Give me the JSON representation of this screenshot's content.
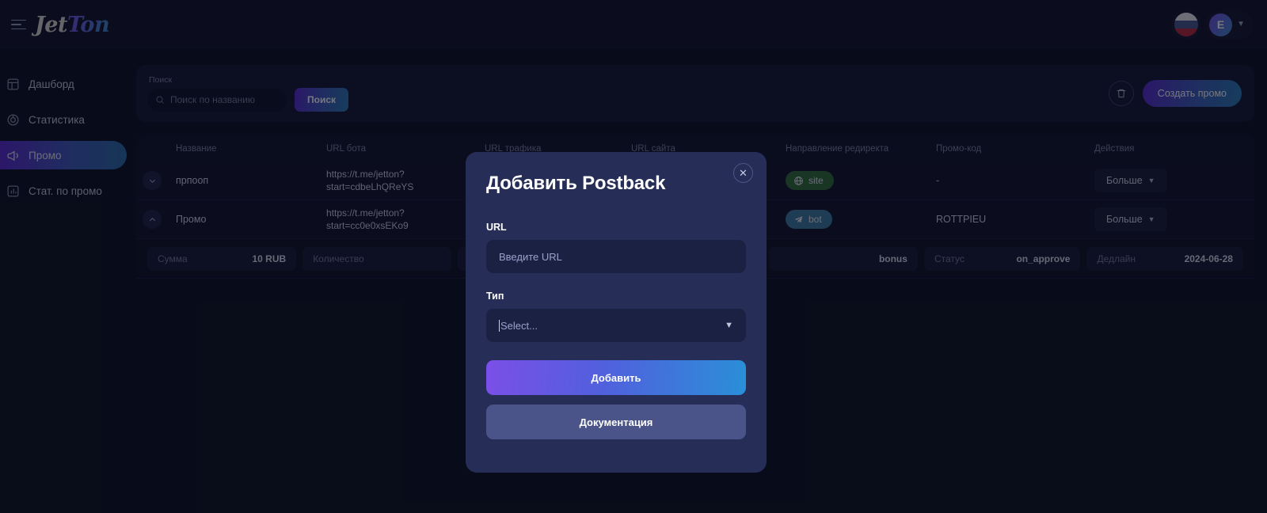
{
  "app": {
    "logo_first": "Jet",
    "logo_second": "Ton"
  },
  "topbar": {
    "menu_icon": "hamburger-icon",
    "language_flag": "russia-flag-icon",
    "avatar_initial": "E",
    "user_chevron": "chevron-down-icon"
  },
  "sidebar": {
    "items": [
      {
        "label": "Дашборд",
        "icon": "dashboard-icon",
        "active": false
      },
      {
        "label": "Статистика",
        "icon": "statistics-icon",
        "active": false
      },
      {
        "label": "Промо",
        "icon": "megaphone-icon",
        "active": true
      },
      {
        "label": "Стат. по промо",
        "icon": "barchart-icon",
        "active": false
      }
    ]
  },
  "toolbar": {
    "search_label": "Поиск",
    "search_placeholder": "Поиск по названию",
    "search_value": "",
    "search_icon": "search-icon",
    "search_button": "Поиск",
    "delete_icon": "trash-icon",
    "create_button": "Создать промо"
  },
  "table": {
    "headers": [
      "Название",
      "URL бота",
      "URL трафика",
      "URL сайта",
      "Направление редиректа",
      "Промо-код",
      "Действия"
    ],
    "rows": [
      {
        "expanded": false,
        "expand_icon": "chevron-down-icon",
        "name": "прпооп",
        "bot_url_line1": "https://t.me/jetton?",
        "bot_url_line2": "start=cdbeLhQReYS",
        "traffic_url": "",
        "site_url": "",
        "redirect_label": "site",
        "redirect_icon": "globe-icon",
        "redirect_kind": "site",
        "promo_code": "-",
        "action_label": "Больше",
        "action_icon": "chevron-down-icon"
      },
      {
        "expanded": true,
        "expand_icon": "chevron-up-icon",
        "name": "Промо",
        "bot_url_line1": "https://t.me/jetton?",
        "bot_url_line2": "start=cc0e0xsEKo9",
        "traffic_url": "",
        "site_url": "",
        "redirect_label": "bot",
        "redirect_icon": "telegram-icon",
        "redirect_kind": "bot",
        "promo_code": "ROTTPIEU",
        "action_label": "Больше",
        "action_icon": "chevron-down-icon"
      }
    ],
    "detail_fields": [
      {
        "label": "Сумма",
        "value": "10 RUB"
      },
      {
        "label": "Количество",
        "value": ""
      },
      {
        "label": "",
        "value": ""
      },
      {
        "label": "",
        "value": ""
      },
      {
        "label": "",
        "value": "bonus"
      },
      {
        "label": "Статус",
        "value": "on_approve"
      },
      {
        "label": "Дедлайн",
        "value": "2024-06-28"
      }
    ]
  },
  "modal": {
    "title": "Добавить Postback",
    "close_icon": "close-icon",
    "url_label": "URL",
    "url_placeholder": "Введите URL",
    "url_value": "",
    "type_label": "Тип",
    "type_placeholder": "Select...",
    "type_chevron": "chevron-down-icon",
    "primary_button": "Добавить",
    "secondary_button": "Документация"
  },
  "colors": {
    "accent_purple": "#7b4fe8",
    "accent_blue": "#2a8fd8",
    "badge_site": "#2f7036",
    "badge_bot": "#3c7ca3",
    "modal_bg": "#262e57",
    "page_bg": "#0d1020"
  }
}
